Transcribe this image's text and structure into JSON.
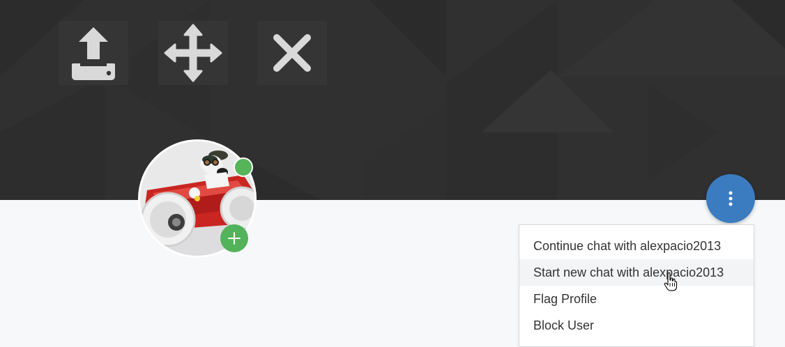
{
  "cover": {
    "tools": [
      {
        "icon": "upload-icon",
        "color": "#d9d9d9"
      },
      {
        "icon": "move-icon",
        "color": "#d9d9d9"
      },
      {
        "icon": "close-icon",
        "color": "#d9d9d9"
      }
    ],
    "background_color": "#303030"
  },
  "profile": {
    "avatar": {
      "subject": "snoopy-toy-race-car"
    },
    "status": {
      "online": true,
      "color": "#56b45a"
    },
    "add_button": {
      "icon": "plus-icon",
      "color": "#52b35a"
    }
  },
  "actions": {
    "fab": {
      "icon": "more-vertical-icon",
      "color": "#3b7cc1"
    },
    "menu": {
      "items": [
        {
          "label": "Continue chat with alexpacio2013",
          "hovered": false
        },
        {
          "label": "Start new chat with alexpacio2013",
          "hovered": true
        },
        {
          "label": "Flag Profile",
          "hovered": false
        },
        {
          "label": "Block User",
          "hovered": false
        }
      ]
    }
  }
}
